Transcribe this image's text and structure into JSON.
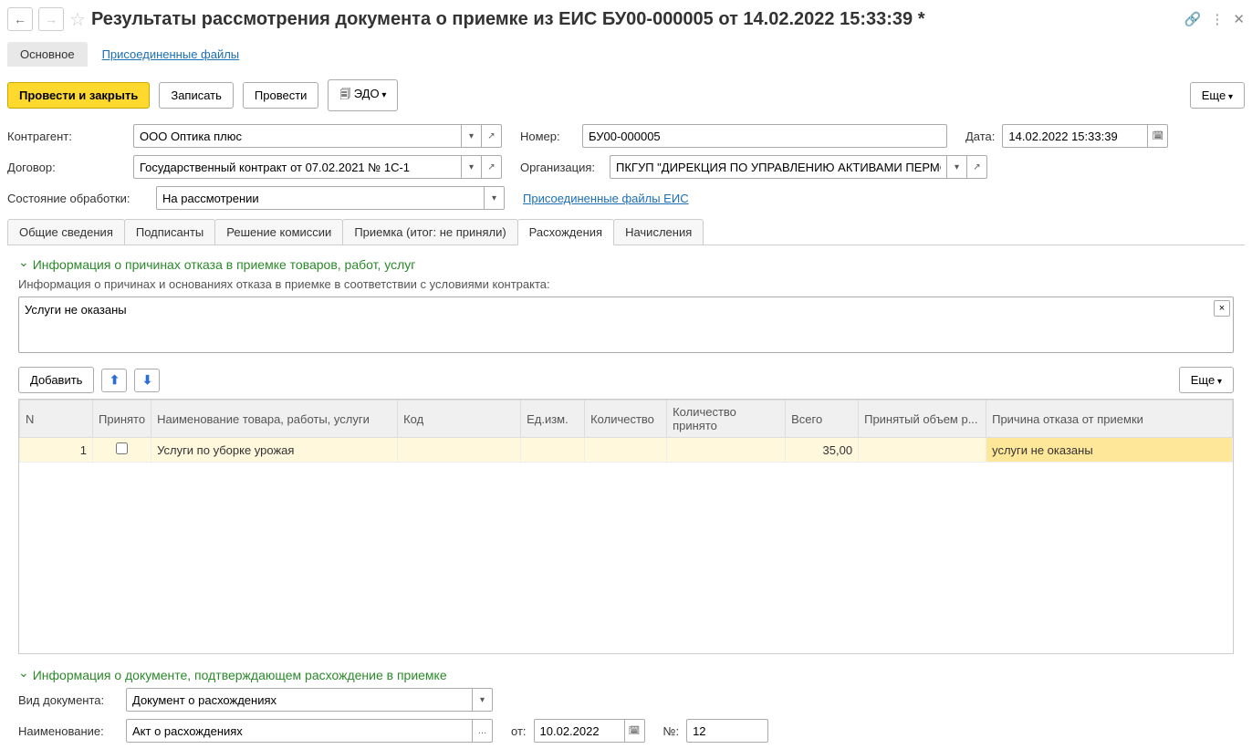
{
  "title": "Результаты рассмотрения документа о приемке из ЕИС БУ00-000005 от 14.02.2022 15:33:39 *",
  "view_tabs": {
    "main": "Основное",
    "files": "Присоединенные файлы"
  },
  "toolbar": {
    "post_close": "Провести и закрыть",
    "save": "Записать",
    "post": "Провести",
    "edo": "ЭДО",
    "more": "Еще"
  },
  "form": {
    "contractor_label": "Контрагент:",
    "contractor_value": "ООО Оптика плюс",
    "number_label": "Номер:",
    "number_value": "БУ00-000005",
    "date_label": "Дата:",
    "date_value": "14.02.2022 15:33:39",
    "contract_label": "Договор:",
    "contract_value": "Государственный контракт от 07.02.2021 № 1С-1",
    "org_label": "Организация:",
    "org_value": "ПКГУП \"ДИРЕКЦИЯ ПО УПРАВЛЕНИЮ АКТИВАМИ ПЕРМС",
    "state_label": "Состояние обработки:",
    "state_value": "На рассмотрении",
    "files_link": "Присоединенные файлы ЕИС"
  },
  "tabs": [
    "Общие сведения",
    "Подписанты",
    "Решение комиссии",
    "Приемка (итог: не приняли)",
    "Расхождения",
    "Начисления"
  ],
  "section1": {
    "title": "Информация о причинах отказа в приемке товаров, работ, услуг",
    "sub": "Информация о причинах и основаниях отказа в приемке в соответствии с условиями контракта:",
    "text": "Услуги не оказаны"
  },
  "table_toolbar": {
    "add": "Добавить",
    "more": "Еще"
  },
  "table": {
    "headers": [
      "N",
      "Принято",
      "Наименование товара, работы, услуги",
      "Код",
      "Ед.изм.",
      "Количество",
      "Количество принято",
      "Всего",
      "Принятый объем р...",
      "Причина отказа от приемки"
    ],
    "rows": [
      {
        "n": "1",
        "accepted": false,
        "name": "Услуги по уборке урожая",
        "code": "",
        "unit": "",
        "qty": "",
        "qty_acc": "",
        "total": "35,00",
        "acc_vol": "",
        "reason": "услуги не оказаны"
      }
    ]
  },
  "section2": {
    "title": "Информация о документе, подтверждающем расхождение в приемке",
    "doc_type_label": "Вид документа:",
    "doc_type_value": "Документ о расхождениях",
    "name_label": "Наименование:",
    "name_value": "Акт о расхождениях",
    "from_label": "от:",
    "from_value": "10.02.2022",
    "num_label": "№:",
    "num_value": "12"
  }
}
